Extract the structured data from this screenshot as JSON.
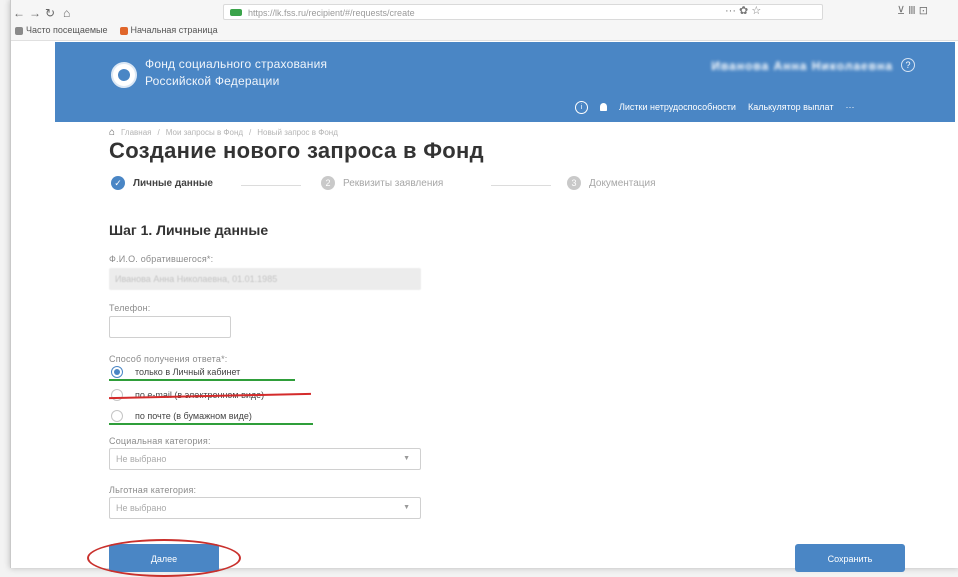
{
  "browser": {
    "url": "https://lk.fss.ru/recipient/#/requests/create",
    "bookmarks": [
      "Часто посещаемые",
      "Начальная страница"
    ],
    "right_icons": [
      "··· ✿ ☆",
      "⊻  Ⅲ  ⊡"
    ]
  },
  "header": {
    "org_line1": "Фонд социального страхования",
    "org_line2": "Российской Федерации",
    "user_name": "Иванова Анна Николаевна",
    "help": "?",
    "nav": {
      "info": "i",
      "sick_leave": "Листки нетрудоспособности",
      "calculator": "Калькулятор выплат",
      "more": "···"
    }
  },
  "breadcrumb": {
    "home": "⌂",
    "items": [
      "Главная",
      "/",
      "Мои запросы в Фонд",
      "/",
      "Новый запрос в Фонд"
    ]
  },
  "page": {
    "title": "Создание нового запроса в Фонд"
  },
  "stepper": {
    "steps": [
      {
        "label": "Личные данные",
        "symbol": "✓"
      },
      {
        "label": "Реквизиты заявления",
        "symbol": "2"
      },
      {
        "label": "Документация",
        "symbol": "3"
      }
    ]
  },
  "form": {
    "step_title": "Шаг 1. Личные данные",
    "fio_label": "Ф.И.О. обратившегося*:",
    "fio_value": "Иванова Анна Николаевна, 01.01.1985",
    "phone_label": "Телефон:",
    "answer_label": "Способ получения ответа*:",
    "answer_options": [
      "только в Личный кабинет",
      "по e-mail (в электронном виде)",
      "по почте (в бумажном виде)"
    ],
    "social_label": "Социальная категория:",
    "social_value": "Не выбрано",
    "privileged_label": "Льготная категория:",
    "privileged_value": "Не выбрано",
    "chevron": "▼"
  },
  "actions": {
    "next_label": "Далее",
    "save_label": "Сохранить"
  },
  "colors": {
    "header_blue": "#4a86c5",
    "annotation_green": "#2f9e3a",
    "annotation_red": "#d42b2b"
  }
}
